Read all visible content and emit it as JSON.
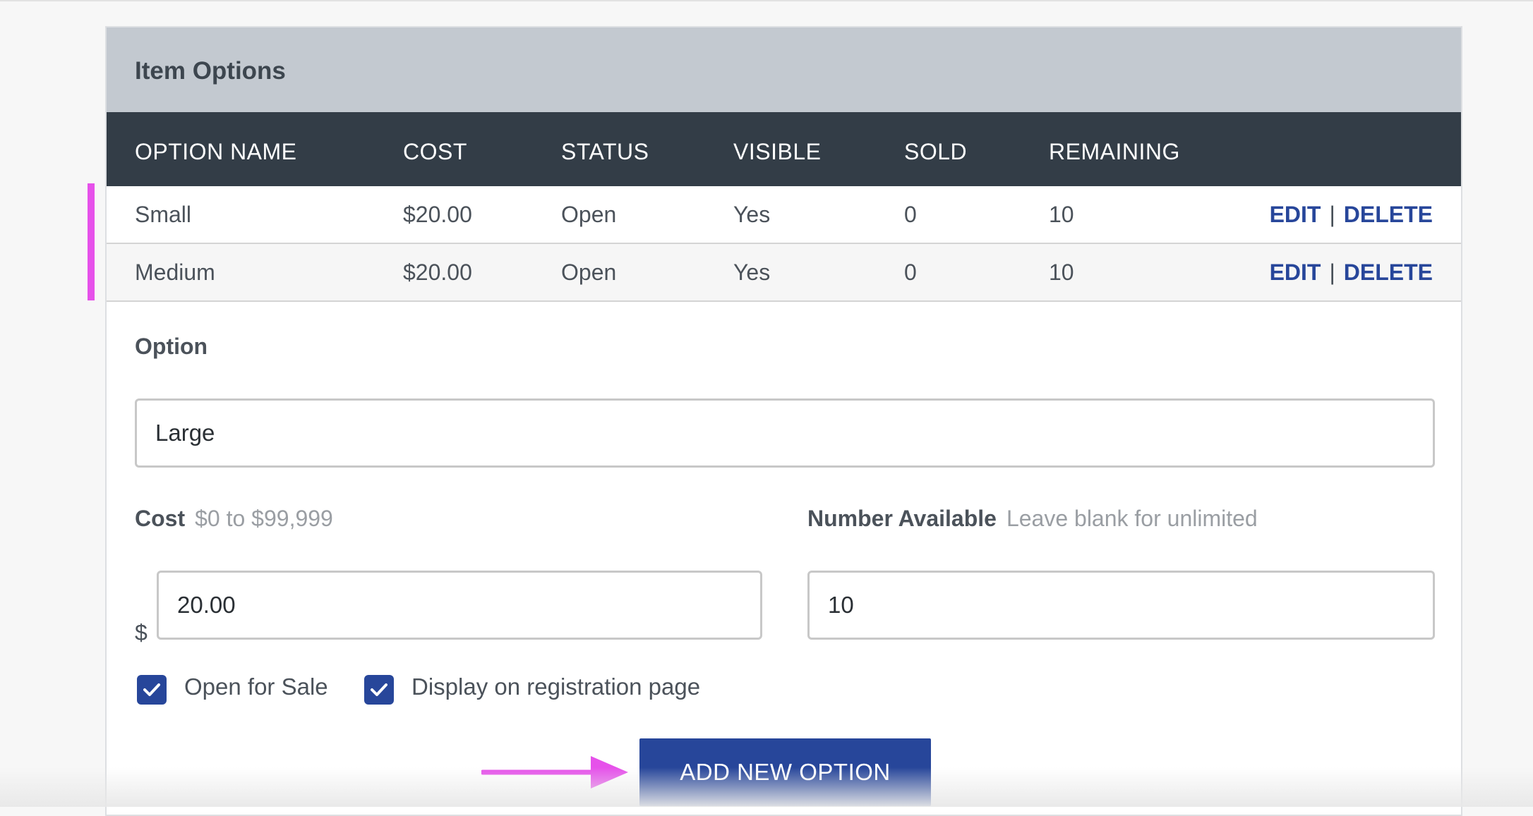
{
  "card": {
    "title": "Item Options"
  },
  "table": {
    "headers": [
      "OPTION NAME",
      "COST",
      "STATUS",
      "VISIBLE",
      "SOLD",
      "REMAINING"
    ],
    "rows": [
      {
        "name": "Small",
        "cost": "$20.00",
        "status": "Open",
        "visible": "Yes",
        "sold": "0",
        "remaining": "10"
      },
      {
        "name": "Medium",
        "cost": "$20.00",
        "status": "Open",
        "visible": "Yes",
        "sold": "0",
        "remaining": "10"
      }
    ],
    "edit_label": "EDIT",
    "separator": "|",
    "delete_label": "DELETE"
  },
  "form": {
    "option_label": "Option",
    "option_value": "Large",
    "cost_label": "Cost",
    "cost_hint": "$0 to $99,999",
    "currency_symbol": "$",
    "cost_value": "20.00",
    "number_label": "Number Available",
    "number_hint": "Leave blank for unlimited",
    "number_value": "10",
    "open_for_sale_label": "Open for Sale",
    "open_for_sale_checked": true,
    "display_label": "Display on registration page",
    "display_checked": true,
    "add_button_label": "ADD NEW OPTION"
  },
  "colors": {
    "accent": "#27469a",
    "header_bg": "#c3c9d0",
    "table_header_bg": "#333d47",
    "annotation": "#e651ea"
  },
  "annotations": {
    "rows_marker": "highlight-bar",
    "button_pointer": "arrow-right-icon"
  }
}
